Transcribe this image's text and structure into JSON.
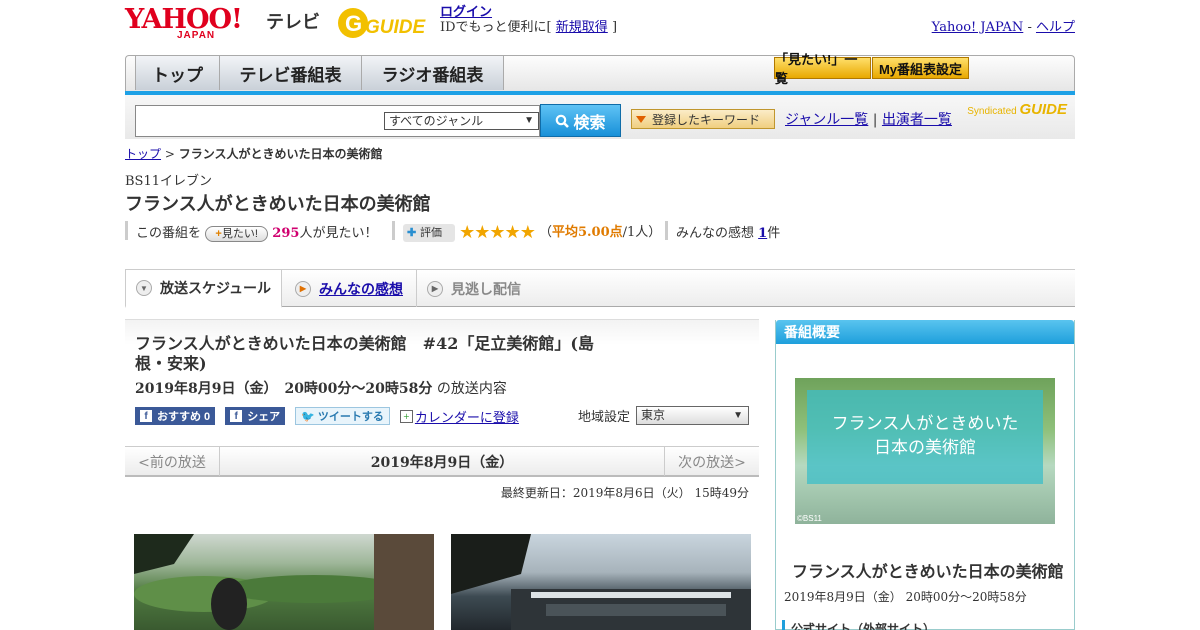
{
  "header": {
    "logo_yahoo": "YAHOO!",
    "logo_japan": "JAPAN",
    "logo_tv": "テレビ",
    "logo_guide": "GUIDE",
    "login": "ログイン",
    "login_sub_prefix": "IDでもっと便利に[",
    "register": "新規取得",
    "login_sub_suffix": "]",
    "yahoo_japan_link": "Yahoo! JAPAN",
    "sep": "-",
    "help": "ヘルプ"
  },
  "nav": {
    "tabs": [
      {
        "label": "トップ"
      },
      {
        "label": "テレビ番組表"
      },
      {
        "label": "ラジオ番組表"
      }
    ],
    "mitai_list": "「見たい!」一覧",
    "my_settings": "My番組表設定"
  },
  "search": {
    "placeholder": "",
    "genre_selected": "すべてのジャンル",
    "button": "検索",
    "keyword_button": "登録したキーワード",
    "genre_list": "ジャンル一覧",
    "divider": "|",
    "performer_list": "出演者一覧",
    "syndicated": "Syndicated"
  },
  "breadcrumb": {
    "top": "トップ",
    "sep": ">",
    "current": "フランス人がときめいた日本の美術館"
  },
  "program": {
    "channel": "BS11イレブン",
    "title": "フランス人がときめいた日本の美術館",
    "want_prefix": "この番組を",
    "want_button": "見たい!",
    "want_count": "295",
    "want_suffix": "人が見たい！",
    "rating_label": "評価",
    "stars": "★★★★★",
    "avg_open": "（",
    "avg": "平均5.00点",
    "avg_close": "/1人）",
    "impressions_prefix": "みんなの感想",
    "impressions_count": "1",
    "impressions_suffix": "件"
  },
  "tabs": {
    "schedule": "放送スケジュール",
    "impressions": "みんなの感想",
    "streaming": "見逃し配信"
  },
  "episode": {
    "title": "フランス人がときめいた日本の美術館　#42「足立美術館」(島根・安来)",
    "date": "2019年8月9日（金）　20時00分～20時58分",
    "date_suffix": "の放送内容",
    "fb_recommend": "おすすめ 0",
    "fb_share": "シェア",
    "tweet": "ツイートする",
    "calendar": "カレンダーに登録",
    "region_label": "地域設定",
    "region_selected": "東京"
  },
  "pager": {
    "prev": "<前の放送",
    "current": "2019年8月9日（金）",
    "next": "次の放送>"
  },
  "updated": "最終更新日：2019年8月6日（火） 15時49分",
  "side": {
    "heading": "番組概要",
    "image_text_1": "フランス人がときめいた",
    "image_text_2": "日本の美術館",
    "copyright": "©BS11",
    "title": "フランス人がときめいた日本の美術館",
    "date": "2019年8月9日（金） 20時00分～20時58分",
    "link": "公式サイト（外部サイト）"
  }
}
